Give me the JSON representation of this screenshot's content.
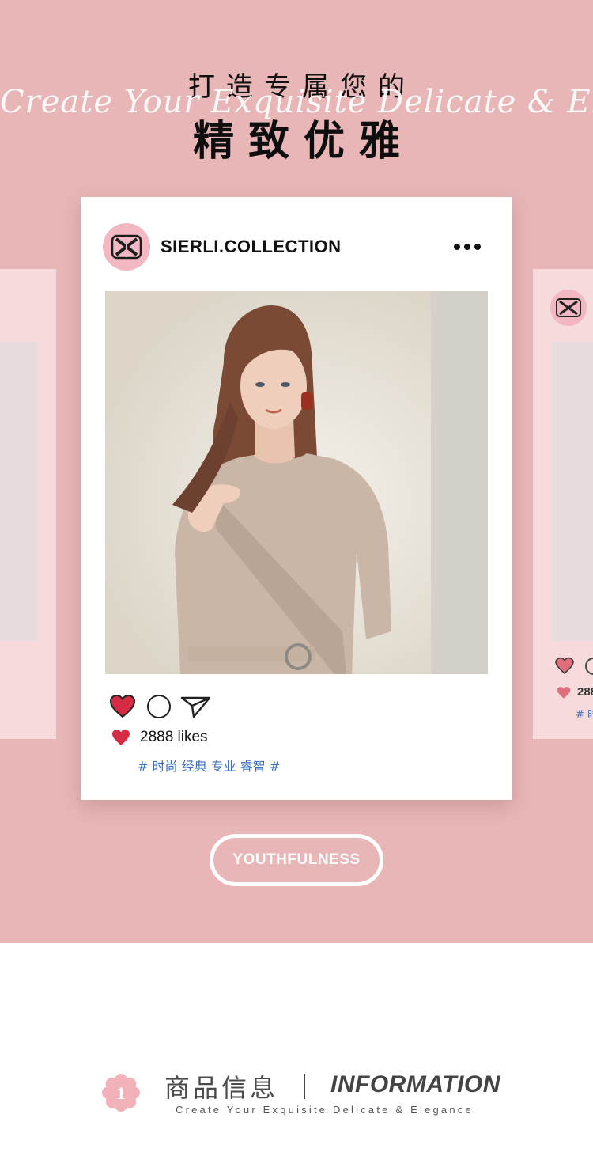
{
  "header": {
    "title_top": "打造专属您的",
    "script_line": "Create Your Exquisite Delicate & Elegance",
    "title_main": "精致优雅"
  },
  "post": {
    "account": "SIERLI.COLLECTION",
    "likes": "2888 likes",
    "tags": "# 时尚 经典 专业 睿智 #"
  },
  "side_right": {
    "likes_partial": "288",
    "tag_partial": "# 时"
  },
  "button": {
    "label": "YOUTHFULNESS"
  },
  "info": {
    "number": "1",
    "title_cn": "商品信息",
    "title_en": "INFORMATION",
    "subtitle": "Create Your Exquisite Delicate & Elegance"
  },
  "colors": {
    "background_pink": "#e8b6b6",
    "card_pink": "#f7dadc",
    "heart_red": "#d72a43",
    "tag_blue": "#3a6fc4"
  },
  "icons": [
    "brand-logo-icon",
    "more-dots-icon",
    "heart-icon",
    "comment-icon",
    "send-icon",
    "flower-badge-icon"
  ]
}
